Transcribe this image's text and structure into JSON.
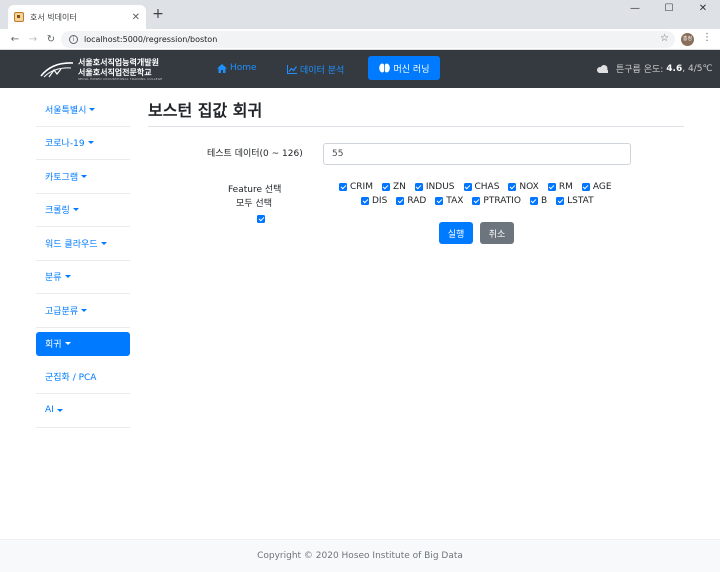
{
  "browser": {
    "tab_title": "호서 빅데이터",
    "tab_close": "✕",
    "new_tab": "+",
    "win_minimize": "—",
    "win_maximize": "☐",
    "win_close": "✕",
    "url": "localhost:5000/regression/boston",
    "profile_initials": "홍정"
  },
  "navbar": {
    "logo_line1": "서울호서직업능력개발원",
    "logo_line2": "서울호서직업전문학교",
    "logo_line3": "SEOUL HOSEO OCCUPATIONAL TRAINING COLLEGE",
    "links": [
      {
        "label": "Home",
        "icon": "home-icon"
      },
      {
        "label": "데이터 분석",
        "icon": "line-chart-icon"
      },
      {
        "label": "머신 러닝",
        "icon": "brain-icon"
      }
    ],
    "weather_label": "튼구름 온도:",
    "weather_temp": "4.6",
    "weather_range": ", 4/5℃"
  },
  "sidebar": {
    "items": [
      {
        "label": "서울특별시",
        "caret": true
      },
      {
        "label": "코로나-19",
        "caret": true
      },
      {
        "label": "카토그램",
        "caret": true
      },
      {
        "label": "크롤링",
        "caret": true
      },
      {
        "label": "워드 클라우드",
        "caret": true
      },
      {
        "label": "분류",
        "caret": true
      },
      {
        "label": "고급분류",
        "caret": true
      },
      {
        "label": "회귀",
        "caret": true,
        "active": true
      },
      {
        "label": "군집화 / PCA",
        "caret": false
      },
      {
        "label": "AI",
        "caret": true
      }
    ]
  },
  "main": {
    "title": "보스턴 집값 회귀",
    "test_label": "테스트 데이터(0 ~ 126)",
    "test_value": "55",
    "feature_label": "Feature 선택",
    "select_all_label": "모두 선택",
    "features_row1": [
      "CRIM",
      "ZN",
      "INDUS",
      "CHAS",
      "NOX",
      "RM",
      "AGE"
    ],
    "features_row2": [
      "DIS",
      "RAD",
      "TAX",
      "PTRATIO",
      "B",
      "LSTAT"
    ],
    "run_button": "실행",
    "cancel_button": "취소"
  },
  "footer": {
    "copyright": "Copyright © 2020 Hoseo Institute of Big Data"
  },
  "colors": {
    "primary": "#007bff",
    "secondary": "#6c757d",
    "navbar_bg": "#343a40"
  }
}
